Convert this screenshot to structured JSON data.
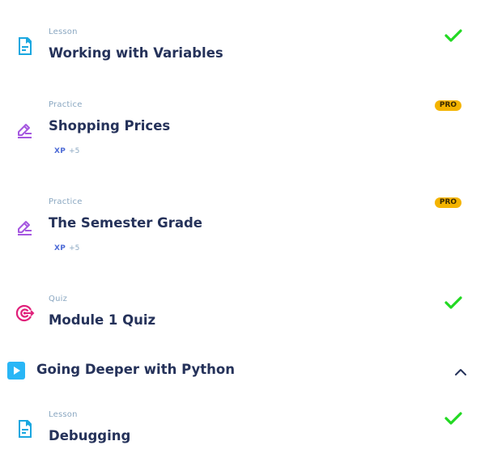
{
  "items": [
    {
      "type": "Lesson",
      "title": "Working with Variables",
      "status": "completed",
      "icon": "lesson-document-icon"
    },
    {
      "type": "Practice",
      "title": "Shopping Prices",
      "badge": "PRO",
      "xp_label": "XP",
      "xp_value": "+5",
      "icon": "practice-pencil-icon"
    },
    {
      "type": "Practice",
      "title": "The Semester Grade",
      "badge": "PRO",
      "xp_label": "XP",
      "xp_value": "+5",
      "icon": "practice-pencil-icon"
    },
    {
      "type": "Quiz",
      "title": "Module 1 Quiz",
      "status": "completed",
      "icon": "quiz-target-icon"
    }
  ],
  "section": {
    "title": "Going Deeper with Python",
    "expanded": true,
    "icon": "play-icon",
    "toggle_icon": "chevron-up-icon"
  },
  "section_items": [
    {
      "type": "Lesson",
      "title": "Debugging",
      "status": "completed",
      "icon": "lesson-document-icon"
    }
  ],
  "colors": {
    "title": "#25325a",
    "type_label": "#8aa7c1",
    "lesson_icon": "#1aa7e0",
    "practice_icon": "#a557e0",
    "quiz_icon": "#e0207a",
    "check": "#22d922",
    "pro_badge": "#f4b400",
    "section_icon": "#29b6f6"
  }
}
